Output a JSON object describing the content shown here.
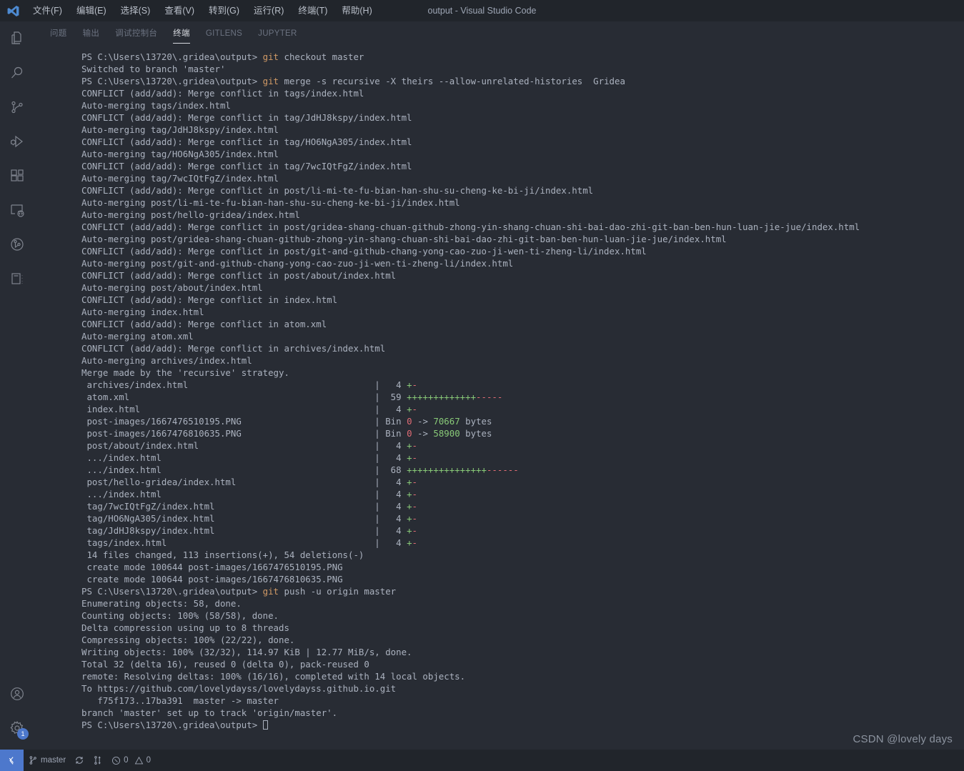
{
  "window": {
    "title": "output - Visual Studio Code",
    "logo_icon": "vscode-logo-icon"
  },
  "menubar": {
    "items": [
      {
        "label": "文件(F)",
        "name": "menu-file"
      },
      {
        "label": "编辑(E)",
        "name": "menu-edit"
      },
      {
        "label": "选择(S)",
        "name": "menu-selection"
      },
      {
        "label": "查看(V)",
        "name": "menu-view"
      },
      {
        "label": "转到(G)",
        "name": "menu-go"
      },
      {
        "label": "运行(R)",
        "name": "menu-run"
      },
      {
        "label": "终端(T)",
        "name": "menu-terminal"
      },
      {
        "label": "帮助(H)",
        "name": "menu-help"
      }
    ]
  },
  "activitybar": {
    "top_items": [
      {
        "icon": "files-explorer-icon"
      },
      {
        "icon": "search-icon"
      },
      {
        "icon": "source-control-icon"
      },
      {
        "icon": "run-and-debug-icon"
      },
      {
        "icon": "extensions-icon"
      },
      {
        "icon": "remote-explorer-icon"
      },
      {
        "icon": "gitlens-icon"
      },
      {
        "icon": "jupyter-notebook-icon"
      }
    ],
    "bottom_items": [
      {
        "icon": "account-icon",
        "badge": ""
      },
      {
        "icon": "settings-gear-icon",
        "badge": "1"
      }
    ]
  },
  "panel": {
    "tabs": [
      {
        "label": "问题",
        "name": "tab-problems",
        "active": false
      },
      {
        "label": "输出",
        "name": "tab-output",
        "active": false
      },
      {
        "label": "调试控制台",
        "name": "tab-debug-console",
        "active": false
      },
      {
        "label": "终端",
        "name": "tab-terminal",
        "active": true
      },
      {
        "label": "GITLENS",
        "name": "tab-gitlens",
        "active": false
      },
      {
        "label": "JUPYTER",
        "name": "tab-jupyter",
        "active": false
      }
    ]
  },
  "terminal": {
    "prompt": "PS C:\\Users\\13720\\.gridea\\output> ",
    "lines": [
      [
        {
          "t": "PS C:\\Users\\13720\\.gridea\\output> ",
          "c": "txt"
        },
        {
          "t": "git",
          "c": "cmd"
        },
        {
          "t": " checkout master",
          "c": "txt"
        }
      ],
      [
        {
          "t": "Switched to branch 'master'",
          "c": "txt"
        }
      ],
      [
        {
          "t": "PS C:\\Users\\13720\\.gridea\\output> ",
          "c": "txt"
        },
        {
          "t": "git",
          "c": "cmd"
        },
        {
          "t": " merge -s recursive -X theirs --allow-unrelated-histories  Gridea",
          "c": "txt"
        }
      ],
      [
        {
          "t": "CONFLICT (add/add): Merge conflict in tags/index.html",
          "c": "txt"
        }
      ],
      [
        {
          "t": "Auto-merging tags/index.html",
          "c": "txt"
        }
      ],
      [
        {
          "t": "CONFLICT (add/add): Merge conflict in tag/JdHJ8kspy/index.html",
          "c": "txt"
        }
      ],
      [
        {
          "t": "Auto-merging tag/JdHJ8kspy/index.html",
          "c": "txt"
        }
      ],
      [
        {
          "t": "CONFLICT (add/add): Merge conflict in tag/HO6NgA305/index.html",
          "c": "txt"
        }
      ],
      [
        {
          "t": "Auto-merging tag/HO6NgA305/index.html",
          "c": "txt"
        }
      ],
      [
        {
          "t": "CONFLICT (add/add): Merge conflict in tag/7wcIQtFgZ/index.html",
          "c": "txt"
        }
      ],
      [
        {
          "t": "Auto-merging tag/7wcIQtFgZ/index.html",
          "c": "txt"
        }
      ],
      [
        {
          "t": "CONFLICT (add/add): Merge conflict in post/li-mi-te-fu-bian-han-shu-su-cheng-ke-bi-ji/index.html",
          "c": "txt"
        }
      ],
      [
        {
          "t": "Auto-merging post/li-mi-te-fu-bian-han-shu-su-cheng-ke-bi-ji/index.html",
          "c": "txt"
        }
      ],
      [
        {
          "t": "Auto-merging post/hello-gridea/index.html",
          "c": "txt"
        }
      ],
      [
        {
          "t": "CONFLICT (add/add): Merge conflict in post/gridea-shang-chuan-github-zhong-yin-shang-chuan-shi-bai-dao-zhi-git-ban-ben-hun-luan-jie-jue/index.html",
          "c": "txt"
        }
      ],
      [
        {
          "t": "Auto-merging post/gridea-shang-chuan-github-zhong-yin-shang-chuan-shi-bai-dao-zhi-git-ban-ben-hun-luan-jie-jue/index.html",
          "c": "txt"
        }
      ],
      [
        {
          "t": "CONFLICT (add/add): Merge conflict in post/git-and-github-chang-yong-cao-zuo-ji-wen-ti-zheng-li/index.html",
          "c": "txt"
        }
      ],
      [
        {
          "t": "Auto-merging post/git-and-github-chang-yong-cao-zuo-ji-wen-ti-zheng-li/index.html",
          "c": "txt"
        }
      ],
      [
        {
          "t": "CONFLICT (add/add): Merge conflict in post/about/index.html",
          "c": "txt"
        }
      ],
      [
        {
          "t": "Auto-merging post/about/index.html",
          "c": "txt"
        }
      ],
      [
        {
          "t": "CONFLICT (add/add): Merge conflict in index.html",
          "c": "txt"
        }
      ],
      [
        {
          "t": "Auto-merging index.html",
          "c": "txt"
        }
      ],
      [
        {
          "t": "CONFLICT (add/add): Merge conflict in atom.xml",
          "c": "txt"
        }
      ],
      [
        {
          "t": "Auto-merging atom.xml",
          "c": "txt"
        }
      ],
      [
        {
          "t": "CONFLICT (add/add): Merge conflict in archives/index.html",
          "c": "txt"
        }
      ],
      [
        {
          "t": "Auto-merging archives/index.html",
          "c": "txt"
        }
      ],
      [
        {
          "t": "Merge made by the 'recursive' strategy.",
          "c": "txt"
        }
      ],
      [
        {
          "t": " archives/index.html                                   |   4 ",
          "c": "txt"
        },
        {
          "t": "+",
          "c": "green"
        },
        {
          "t": "-",
          "c": "red"
        }
      ],
      [
        {
          "t": " atom.xml                                              |  59 ",
          "c": "txt"
        },
        {
          "t": "+++++++++++++",
          "c": "green"
        },
        {
          "t": "-----",
          "c": "red"
        }
      ],
      [
        {
          "t": " index.html                                            |   4 ",
          "c": "txt"
        },
        {
          "t": "+",
          "c": "green"
        },
        {
          "t": "-",
          "c": "red"
        }
      ],
      [
        {
          "t": " post-images/1667476510195.PNG                         | Bin ",
          "c": "txt"
        },
        {
          "t": "0",
          "c": "red"
        },
        {
          "t": " -> ",
          "c": "txt"
        },
        {
          "t": "70667",
          "c": "green"
        },
        {
          "t": " bytes",
          "c": "txt"
        }
      ],
      [
        {
          "t": " post-images/1667476810635.PNG                         | Bin ",
          "c": "txt"
        },
        {
          "t": "0",
          "c": "red"
        },
        {
          "t": " -> ",
          "c": "txt"
        },
        {
          "t": "58900",
          "c": "green"
        },
        {
          "t": " bytes",
          "c": "txt"
        }
      ],
      [
        {
          "t": " post/about/index.html                                 |   4 ",
          "c": "txt"
        },
        {
          "t": "+",
          "c": "green"
        },
        {
          "t": "-",
          "c": "red"
        }
      ],
      [
        {
          "t": " .../index.html                                        |   4 ",
          "c": "txt"
        },
        {
          "t": "+",
          "c": "green"
        },
        {
          "t": "-",
          "c": "red"
        }
      ],
      [
        {
          "t": " .../index.html                                        |  68 ",
          "c": "txt"
        },
        {
          "t": "+++++++++++++++",
          "c": "green"
        },
        {
          "t": "------",
          "c": "red"
        }
      ],
      [
        {
          "t": " post/hello-gridea/index.html                          |   4 ",
          "c": "txt"
        },
        {
          "t": "+",
          "c": "green"
        },
        {
          "t": "-",
          "c": "red"
        }
      ],
      [
        {
          "t": " .../index.html                                        |   4 ",
          "c": "txt"
        },
        {
          "t": "+",
          "c": "green"
        },
        {
          "t": "-",
          "c": "red"
        }
      ],
      [
        {
          "t": " tag/7wcIQtFgZ/index.html                              |   4 ",
          "c": "txt"
        },
        {
          "t": "+",
          "c": "green"
        },
        {
          "t": "-",
          "c": "red"
        }
      ],
      [
        {
          "t": " tag/HO6NgA305/index.html                              |   4 ",
          "c": "txt"
        },
        {
          "t": "+",
          "c": "green"
        },
        {
          "t": "-",
          "c": "red"
        }
      ],
      [
        {
          "t": " tag/JdHJ8kspy/index.html                              |   4 ",
          "c": "txt"
        },
        {
          "t": "+",
          "c": "green"
        },
        {
          "t": "-",
          "c": "red"
        }
      ],
      [
        {
          "t": " tags/index.html                                       |   4 ",
          "c": "txt"
        },
        {
          "t": "+",
          "c": "green"
        },
        {
          "t": "-",
          "c": "red"
        }
      ],
      [
        {
          "t": " 14 files changed, 113 insertions(+), 54 deletions(-)",
          "c": "txt"
        }
      ],
      [
        {
          "t": " create mode 100644 post-images/1667476510195.PNG",
          "c": "txt"
        }
      ],
      [
        {
          "t": " create mode 100644 post-images/1667476810635.PNG",
          "c": "txt"
        }
      ],
      [
        {
          "t": "PS C:\\Users\\13720\\.gridea\\output> ",
          "c": "txt"
        },
        {
          "t": "git",
          "c": "cmd"
        },
        {
          "t": " push -u origin master",
          "c": "txt"
        }
      ],
      [
        {
          "t": "Enumerating objects: 58, done.",
          "c": "txt"
        }
      ],
      [
        {
          "t": "Counting objects: 100% (58/58), done.",
          "c": "txt"
        }
      ],
      [
        {
          "t": "Delta compression using up to 8 threads",
          "c": "txt"
        }
      ],
      [
        {
          "t": "Compressing objects: 100% (22/22), done.",
          "c": "txt"
        }
      ],
      [
        {
          "t": "Writing objects: 100% (32/32), 114.97 KiB | 12.77 MiB/s, done.",
          "c": "txt"
        }
      ],
      [
        {
          "t": "Total 32 (delta 16), reused 0 (delta 0), pack-reused 0",
          "c": "txt"
        }
      ],
      [
        {
          "t": "remote: Resolving deltas: 100% (16/16), completed with 14 local objects.",
          "c": "txt"
        }
      ],
      [
        {
          "t": "To https://github.com/lovelydayss/lovelydayss.github.io.git",
          "c": "txt"
        }
      ],
      [
        {
          "t": "   f75f173..17ba391  master -> master",
          "c": "txt"
        }
      ],
      [
        {
          "t": "branch 'master' set up to track 'origin/master'.",
          "c": "txt"
        }
      ],
      [
        {
          "t": "PS C:\\Users\\13720\\.gridea\\output> ",
          "c": "txt"
        },
        {
          "t": "__CURSOR__",
          "c": "cursor"
        }
      ]
    ]
  },
  "statusbar": {
    "remote_icon": "remote-window-icon",
    "branch_icon": "git-branch-icon",
    "branch_label": "master",
    "sync_icon": "sync-icon",
    "compare_icon": "git-compare-icon",
    "error_icon": "error-icon",
    "error_count": "0",
    "warning_icon": "warning-icon",
    "warning_count": "0"
  },
  "watermark": {
    "text": "CSDN @lovely days"
  },
  "colors": {
    "terminal_bg": "#282c34",
    "titlebar_bg": "#21252b",
    "statusbar_bg": "#21252b",
    "accent_blue": "#4d78cc",
    "text_default": "#abb2bf",
    "green": "#89ca78",
    "red": "#e06c75",
    "orange": "#d19a66"
  }
}
